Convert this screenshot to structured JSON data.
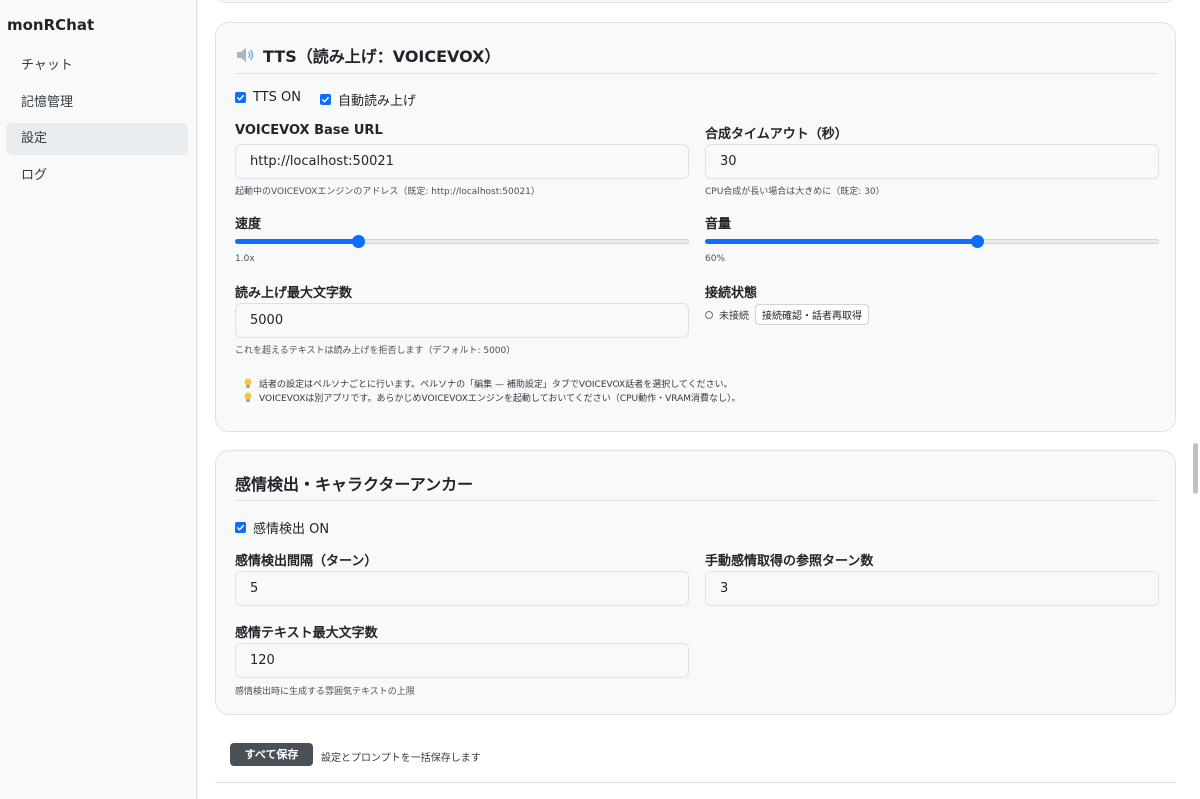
{
  "app": {
    "title": "monRChat"
  },
  "sidebar": {
    "items": [
      {
        "label": "チャット",
        "active": false
      },
      {
        "label": "記憶管理",
        "active": false
      },
      {
        "label": "設定",
        "active": true
      },
      {
        "label": "ログ",
        "active": false
      }
    ]
  },
  "tts": {
    "icon": "speaker-icon",
    "title": "TTS（読み上げ：VOICEVOX）",
    "tts_on_label": "TTS ON",
    "tts_on_checked": true,
    "auto_read_label": "自動読み上げ",
    "auto_read_checked": true,
    "base_url_label": "VOICEVOX Base URL",
    "base_url_value": "http://localhost:50021",
    "base_url_hint": "起動中のVOICEVOXエンジンのアドレス（既定: http://localhost:50021）",
    "timeout_label": "合成タイムアウト（秒）",
    "timeout_value": "30",
    "timeout_hint": "CPU合成が長い場合は大きめに（既定: 30）",
    "speed_label": "速度",
    "speed_value_text": "1.0x",
    "speed_fraction": 0.27,
    "volume_label": "音量",
    "volume_value_text": "60%",
    "volume_fraction": 0.6,
    "max_chars_label": "読み上げ最大文字数",
    "max_chars_value": "5000",
    "max_chars_hint": "これを超えるテキストは読み上げを拒否します（デフォルト: 5000）",
    "connection_label": "接続状態",
    "connection_status": "未接続",
    "connection_button": "接続確認・話者再取得",
    "notes": [
      "話者の設定はペルソナごとに行います。ペルソナの「編集 — 補助設定」タブでVOICEVOX話者を選択してください。",
      "VOICEVOXは別アプリです。あらかじめVOICEVOXエンジンを起動しておいてください（CPU動作・VRAM消費なし）。"
    ]
  },
  "emotion": {
    "title": "感情検出・キャラクターアンカー",
    "detect_on_label": "感情検出 ON",
    "detect_on_checked": true,
    "interval_label": "感情検出間隔（ターン）",
    "interval_value": "5",
    "manual_ref_label": "手動感情取得の参照ターン数",
    "manual_ref_value": "3",
    "max_text_label": "感情テキスト最大文字数",
    "max_text_value": "120",
    "max_text_hint": "感情検出時に生成する雰囲気テキストの上限"
  },
  "footer": {
    "save_label": "すべて保存",
    "save_hint": "設定とプロンプトを一括保存します"
  },
  "colors": {
    "accent": "#0d6efd",
    "save_button": "#495057"
  }
}
